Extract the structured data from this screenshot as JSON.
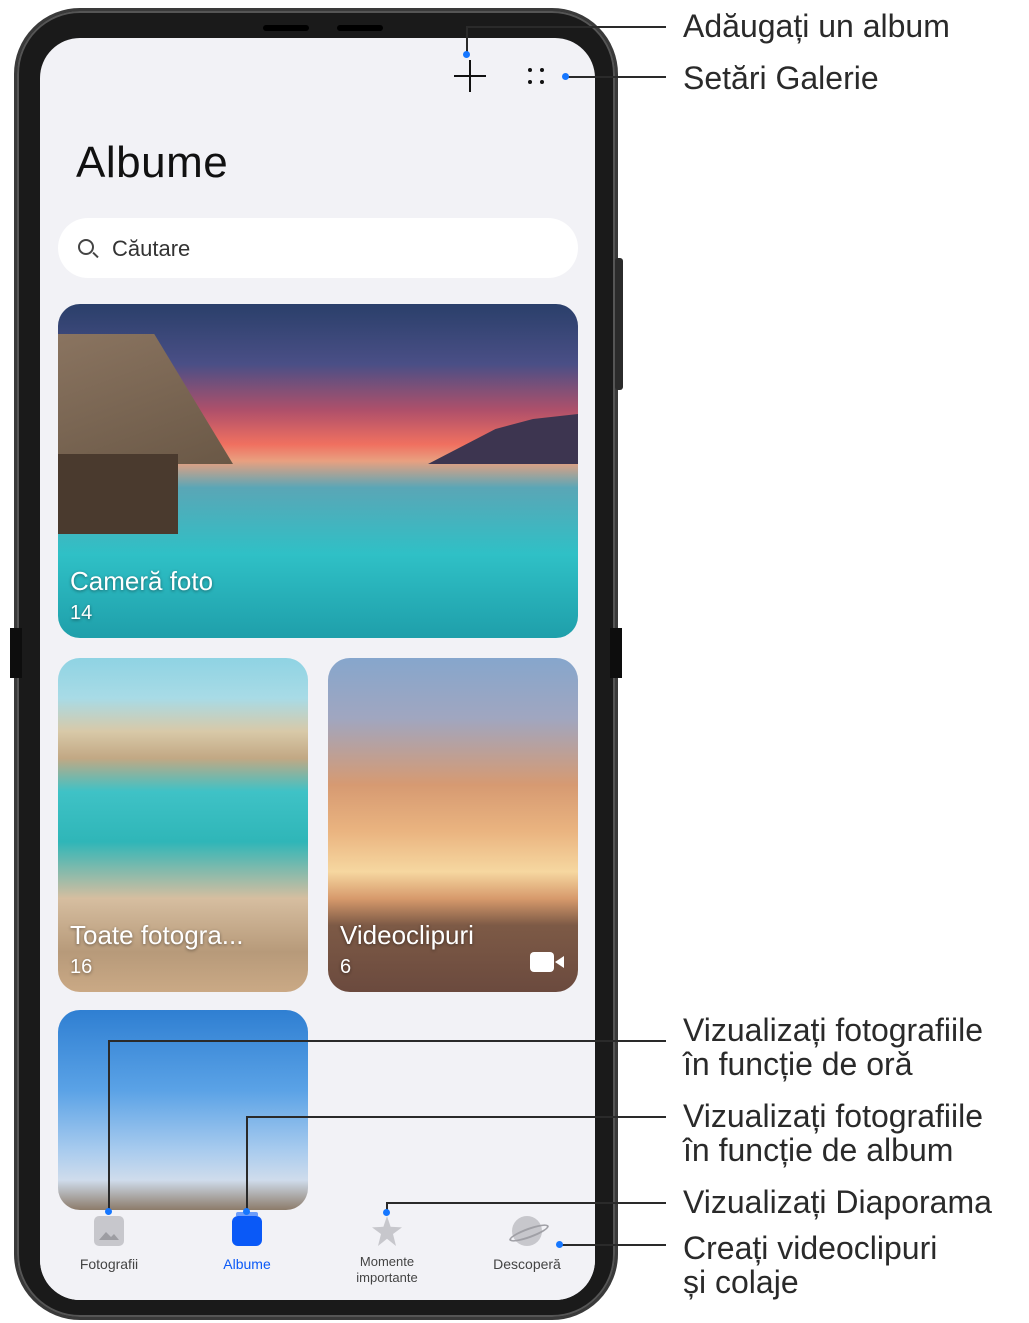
{
  "screen": {
    "title": "Albume",
    "search": {
      "placeholder": "Căutare"
    },
    "albums": [
      {
        "name": "Cameră foto",
        "count": "14"
      },
      {
        "name": "Toate fotogra...",
        "count": "16"
      },
      {
        "name": "Videoclipuri",
        "count": "6"
      }
    ],
    "bottom_nav": [
      {
        "label": "Fotografii",
        "icon": "photos-icon",
        "active": false
      },
      {
        "label": "Albume",
        "icon": "albums-icon",
        "active": true
      },
      {
        "label_line1": "Momente",
        "label_line2": "importante",
        "icon": "star-icon",
        "active": false
      },
      {
        "label": "Descoperă",
        "icon": "planet-icon",
        "active": false
      }
    ],
    "accent_color": "#0a59f7"
  },
  "callouts": {
    "add_album": "Adăugați un album",
    "gallery_settings": "Setări Galerie",
    "view_by_time_1": "Vizualizați fotografiile",
    "view_by_time_2": "în funcție de oră",
    "view_by_album_1": "Vizualizați fotografiile",
    "view_by_album_2": "în funcție de album",
    "view_slideshow": "Vizualizați Diaporama",
    "create_1": "Creați videoclipuri",
    "create_2": "și colaje"
  }
}
